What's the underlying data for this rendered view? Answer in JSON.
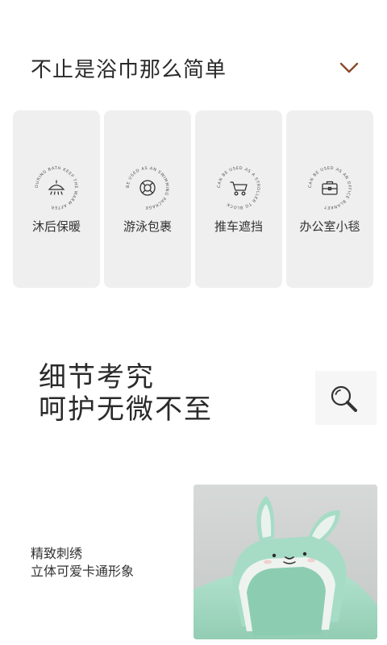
{
  "section": {
    "title": "不止是浴巾那么简单",
    "toggle_icon": "chevron-down-icon"
  },
  "colors": {
    "accent": "#8a4b2a",
    "card_bg": "#efefef",
    "towel": "#a8dcc7"
  },
  "usage_cards": [
    {
      "label": "沐后保暖",
      "ring_text": "DURING BATH KEEP THE WARM AFTER",
      "icon": "shower-icon"
    },
    {
      "label": "游泳包裹",
      "ring_text": "BE USED AS AN SWIMMING PACKAGE",
      "icon": "lifebuoy-icon"
    },
    {
      "label": "推车遮挡",
      "ring_text": "CAN BE USED AS A STROLLER TO BLOCK",
      "icon": "stroller-icon"
    },
    {
      "label": "办公室小毯",
      "ring_text": "CAN BE USED AS AN OFFICE BLANKET",
      "icon": "briefcase-icon"
    }
  ],
  "detail": {
    "line1": "细节考究",
    "line2": "呵护无微不至",
    "zoom_icon": "magnifier-icon"
  },
  "feature": {
    "line1": "精致刺绣",
    "line2": "立体可爱卡通形象",
    "image_alt": "bunny-hooded-towel-photo"
  }
}
